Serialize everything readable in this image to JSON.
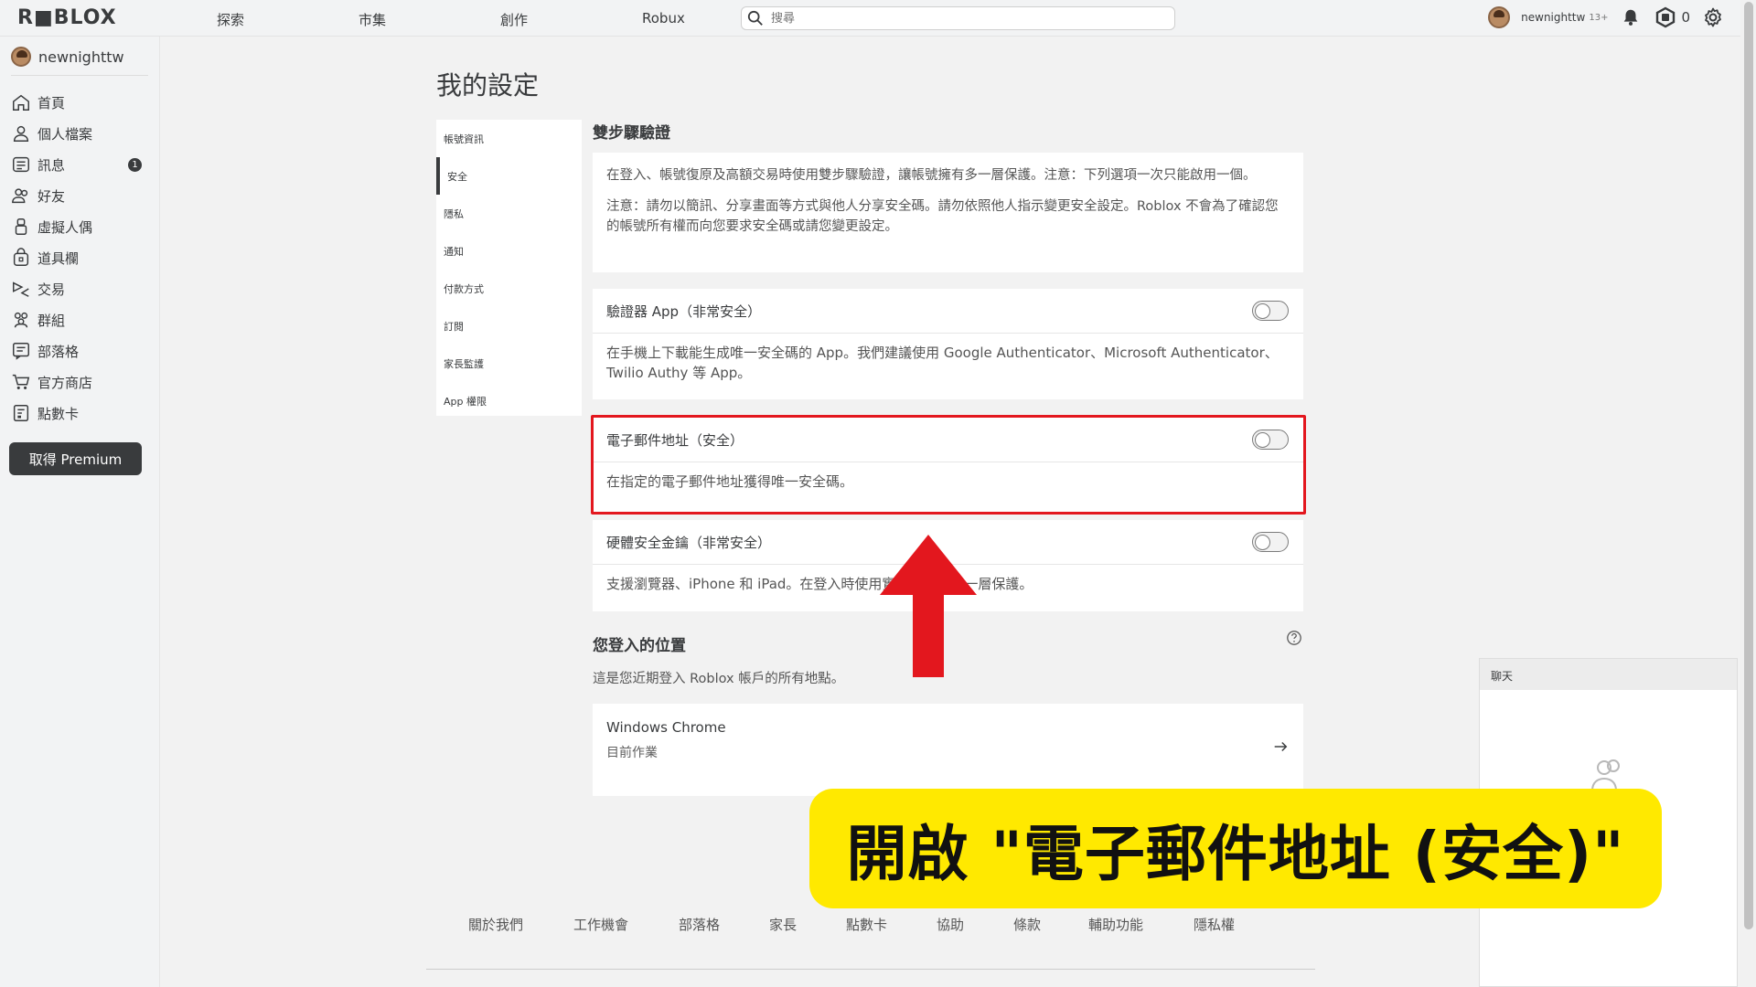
{
  "topbar": {
    "logo": "R■BLOX",
    "nav": [
      "探索",
      "市集",
      "創作",
      "Robux"
    ],
    "search_placeholder": "搜尋",
    "username": "newnighttw",
    "age": "13+",
    "robux_count": "0"
  },
  "sidebar": {
    "username": "newnighttw",
    "items": [
      {
        "label": "首頁",
        "icon": "home-icon"
      },
      {
        "label": "個人檔案",
        "icon": "profile-icon"
      },
      {
        "label": "訊息",
        "icon": "messages-icon",
        "badge": "1"
      },
      {
        "label": "好友",
        "icon": "friends-icon"
      },
      {
        "label": "虛擬人偶",
        "icon": "avatar-icon"
      },
      {
        "label": "道具欄",
        "icon": "inventory-icon"
      },
      {
        "label": "交易",
        "icon": "trade-icon"
      },
      {
        "label": "群組",
        "icon": "groups-icon"
      },
      {
        "label": "部落格",
        "icon": "blog-icon"
      },
      {
        "label": "官方商店",
        "icon": "store-icon"
      },
      {
        "label": "點數卡",
        "icon": "giftcard-icon"
      }
    ],
    "premium_button": "取得 Premium"
  },
  "page": {
    "title": "我的設定",
    "settings_nav": [
      "帳號資訊",
      "安全",
      "隱私",
      "通知",
      "付款方式",
      "訂閱",
      "家長監護",
      "App 權限"
    ],
    "active_tab": "安全"
  },
  "two_step": {
    "title": "雙步驟驗證",
    "intro_1": "在登入、帳號復原及高額交易時使用雙步驟驗證，讓帳號擁有多一層保護。注意：下列選項一次只能啟用一個。",
    "intro_2": "注意：請勿以簡訊、分享畫面等方式與他人分享安全碼。請勿依照他人指示變更安全設定。Roblox 不會為了確認您的帳號所有權而向您要求安全碼或請您變更設定。",
    "authenticator_label": "驗證器 App（非常安全）",
    "authenticator_desc": "在手機上下載能生成唯一安全碼的 App。我們建議使用 Google Authenticator、Microsoft Authenticator、Twilio Authy 等 App。",
    "email_label": "電子郵件地址（安全）",
    "email_desc": "在指定的電子郵件地址獲得唯一安全碼。",
    "key_label": "硬體安全金鑰（非常安全）",
    "key_desc": "支援瀏覽器、iPhone 和 iPad。在登入時使用實體金鑰增加一層保護。"
  },
  "locations": {
    "title": "您登入的位置",
    "subtitle": "這是您近期登入 Roblox 帳戶的所有地點。",
    "device": "Windows Chrome",
    "status": "目前作業"
  },
  "chat": {
    "title": "聊天"
  },
  "footer": [
    "關於我們",
    "工作機會",
    "部落格",
    "家長",
    "點數卡",
    "協助",
    "條款",
    "輔助功能",
    "隱私權"
  ],
  "annotation": {
    "banner_text": "開啟 \"電子郵件地址 (安全)\"",
    "arrow_color": "#e3171e",
    "banner_color": "#ffe900"
  }
}
